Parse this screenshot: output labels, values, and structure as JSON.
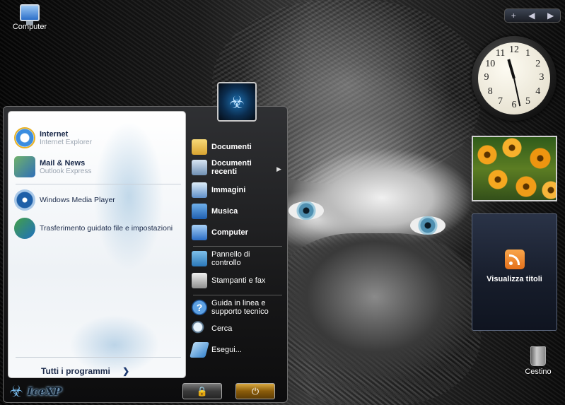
{
  "desktop": {
    "icons": [
      {
        "label": "Computer",
        "icon": "computer-icon"
      },
      {
        "label": "Cestino",
        "icon": "recycle-bin-icon"
      }
    ]
  },
  "sidebar": {
    "controls": {
      "add": "+",
      "prev": "◀",
      "next": "▶"
    },
    "clock": {
      "hour": 11,
      "minute": 28
    },
    "clock_numbers": [
      "12",
      "1",
      "2",
      "3",
      "4",
      "5",
      "6",
      "7",
      "8",
      "9",
      "10",
      "11"
    ],
    "feed_title": "Visualizza titoli"
  },
  "start_menu": {
    "pinned": [
      {
        "title": "Internet",
        "subtitle": "Internet Explorer",
        "icon": "internet-explorer-icon"
      },
      {
        "title": "Mail & News",
        "subtitle": "Outlook Express",
        "icon": "outlook-express-icon"
      }
    ],
    "recent": [
      {
        "label": "Windows Media Player",
        "icon": "media-player-icon"
      },
      {
        "label": "Trasferimento guidato file e impostazioni",
        "icon": "transfer-wizard-icon"
      }
    ],
    "all_programs": "Tutti i programmi",
    "all_programs_arrow": "❯",
    "places": [
      {
        "label": "Documenti",
        "icon": "documents-folder-icon",
        "bold": true
      },
      {
        "label": "Documenti recenti",
        "icon": "recent-documents-icon",
        "bold": true,
        "submenu": true
      },
      {
        "label": "Immagini",
        "icon": "pictures-icon",
        "bold": true
      },
      {
        "label": "Musica",
        "icon": "music-icon",
        "bold": true
      },
      {
        "label": "Computer",
        "icon": "computer-icon",
        "bold": true
      }
    ],
    "system": [
      {
        "label": "Pannello di controllo",
        "icon": "control-panel-icon"
      },
      {
        "label": "Stampanti e fax",
        "icon": "printer-icon"
      }
    ],
    "support": [
      {
        "label": "Guida in linea e supporto tecnico",
        "icon": "help-icon"
      },
      {
        "label": "Cerca",
        "icon": "search-icon"
      },
      {
        "label": "Esegui...",
        "icon": "run-icon"
      }
    ],
    "logo_text": "IceXP",
    "logo_symbol": "☣",
    "user_symbol": "☣",
    "lock_glyph": "🔒",
    "power_glyph": "⏻",
    "submenu_arrow": "▶"
  }
}
